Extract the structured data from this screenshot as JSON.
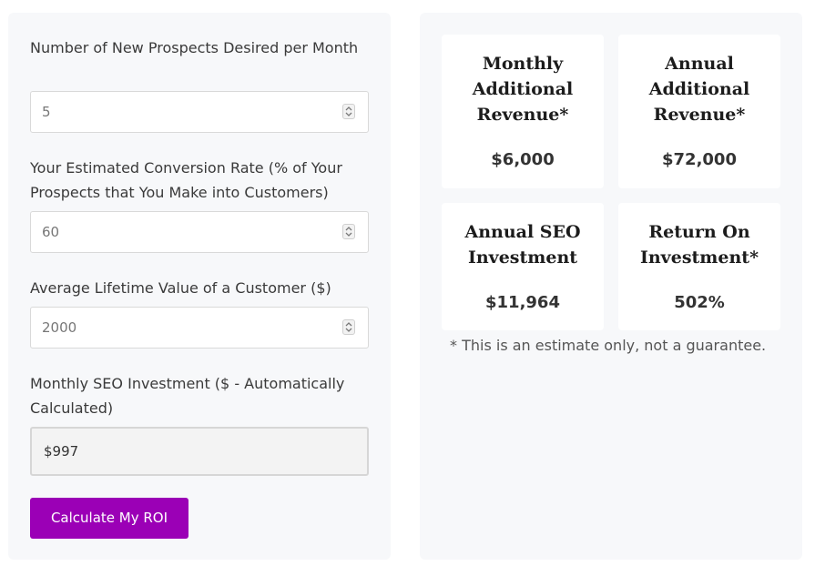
{
  "form": {
    "prospects": {
      "label": "Number of New Prospects Desired per Month",
      "value": "5"
    },
    "conversion_rate": {
      "label": "Your Estimated Conversion Rate (% of Your Prospects that You Make into Customers)",
      "value": "60"
    },
    "lifetime_value": {
      "label": "Average Lifetime Value of a Customer ($)",
      "value": "2000"
    },
    "monthly_seo": {
      "label": "Monthly SEO Investment ($ - Automatically Calculated)",
      "value": "$997"
    },
    "calculate_label": "Calculate My ROI"
  },
  "results": {
    "monthly_revenue": {
      "title": "Monthly\nAdditional\nRevenue*",
      "value": "$6,000"
    },
    "annual_revenue": {
      "title": "Annual\nAdditional\nRevenue*",
      "value": "$72,000"
    },
    "annual_seo": {
      "title": "Annual SEO\nInvestment",
      "value": "$11,964"
    },
    "roi": {
      "title": "Return On\nInvestment*",
      "value": "502%"
    },
    "disclaimer": "* This is an estimate only, not a guarantee."
  },
  "colors": {
    "button": "#9b00b6",
    "panel": "#f7f8fa"
  }
}
